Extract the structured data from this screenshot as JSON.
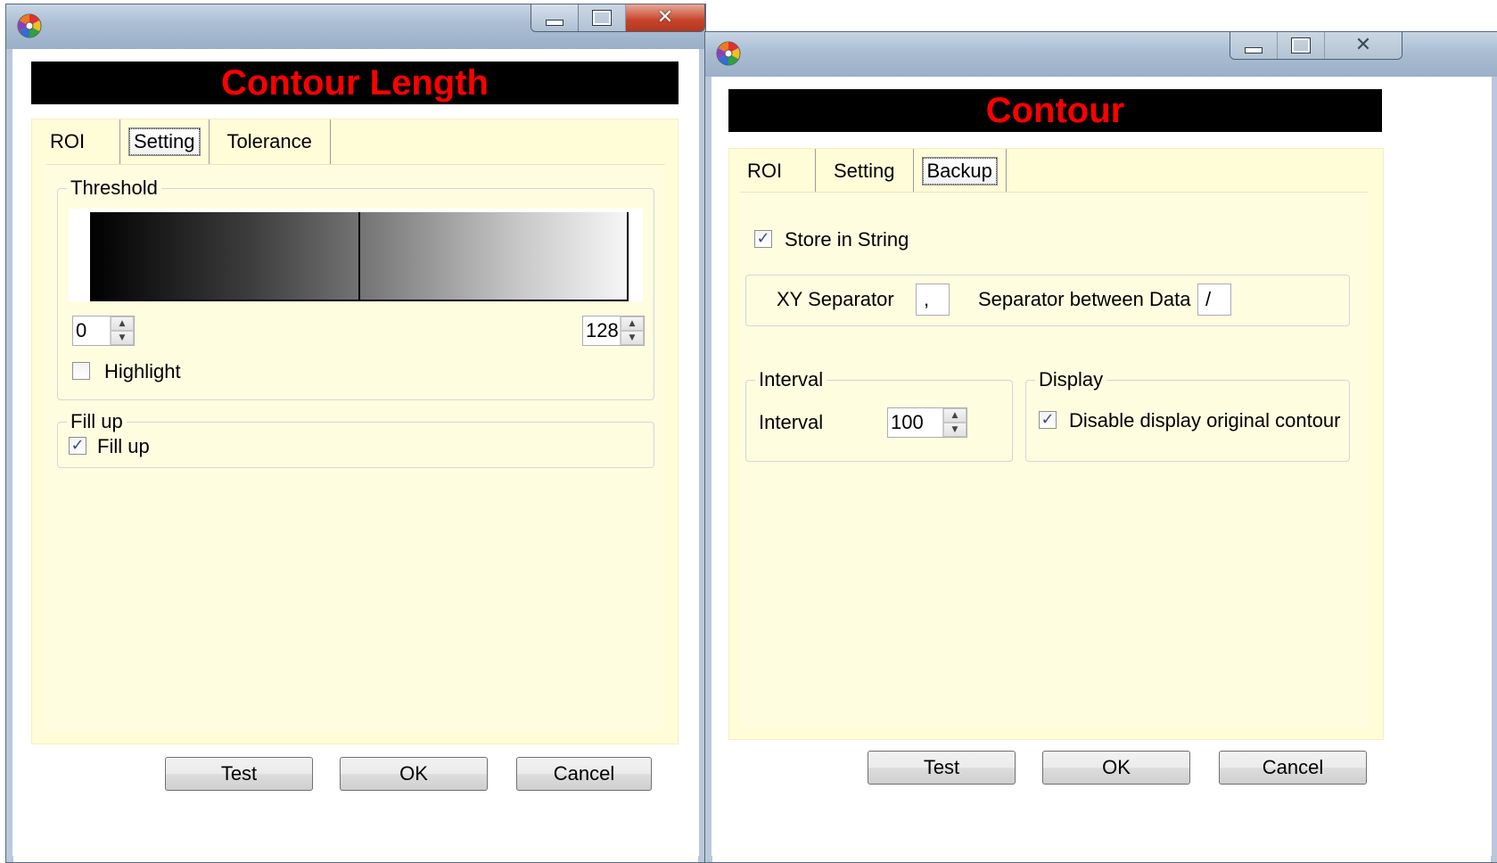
{
  "left_window": {
    "header": "Contour Length",
    "tabs": [
      "ROI",
      "Setting",
      "Tolerance"
    ],
    "active_tab": "Setting",
    "threshold": {
      "title": "Threshold",
      "low_value": "0",
      "high_value": "128",
      "marker_fraction": 0.5,
      "highlight_label": "Highlight",
      "highlight_checked": false
    },
    "fillup": {
      "title": "Fill up",
      "checkbox_label": "Fill up",
      "checked": true
    },
    "buttons": {
      "test": "Test",
      "ok": "OK",
      "cancel": "Cancel"
    }
  },
  "right_window": {
    "header": "Contour",
    "tabs": [
      "ROI",
      "Setting",
      "Backup"
    ],
    "active_tab": "Backup",
    "store_in_string": {
      "label": "Store in String",
      "checked": true
    },
    "separators": {
      "xy_label": "XY Separator",
      "xy_value": ",",
      "data_label": "Separator between Data",
      "data_value": "/"
    },
    "interval": {
      "title": "Interval",
      "label": "Interval",
      "value": "100"
    },
    "display": {
      "title": "Display",
      "checkbox_label": "Disable display original contour",
      "checked": true
    },
    "buttons": {
      "test": "Test",
      "ok": "OK",
      "cancel": "Cancel"
    }
  },
  "colors": {
    "header_bg": "#000000",
    "header_text": "#ff0000",
    "panel_bg": "#fffde0",
    "titlebar": "#aabdd2",
    "close_button": "#c7432a"
  },
  "icons": {
    "app": "color-wheel-icon",
    "minimize": "minimize-icon",
    "maximize": "maximize-icon",
    "close": "close-icon",
    "spin_up": "spin-up-icon",
    "spin_down": "spin-down-icon",
    "checkmark": "checkmark-icon"
  }
}
